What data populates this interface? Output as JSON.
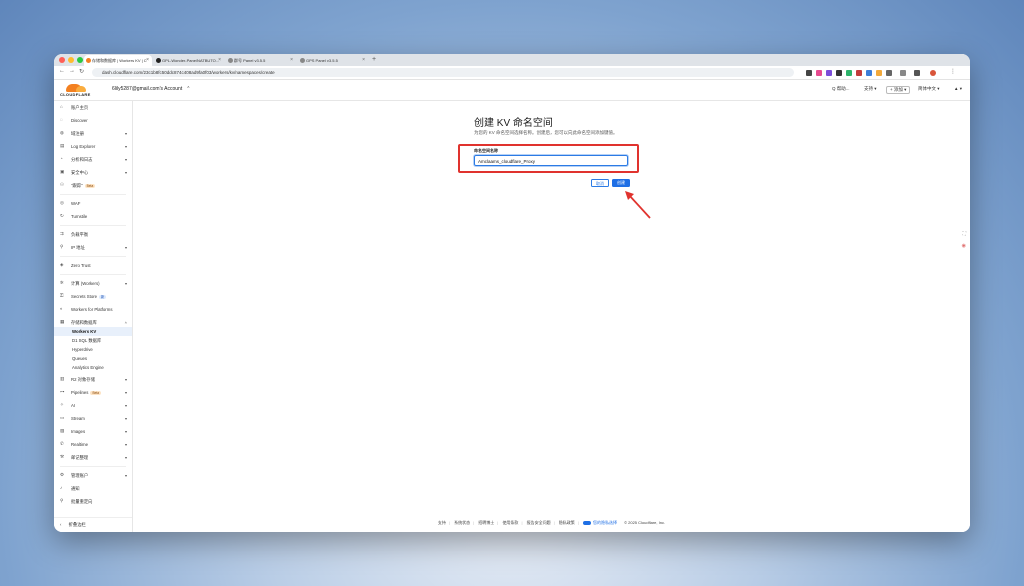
{
  "browser": {
    "tabs": [
      {
        "label": "存储和数据库 | Workers KV | C"
      },
      {
        "label": "GPL-Wonder-Pane/NATBUTO..."
      },
      {
        "label": "群号 Panel v3.5.5"
      },
      {
        "label": "GPS Panel v3.5.5"
      }
    ],
    "url": "dash.cloudflare.com/23c1b8fc50ddc874c408ad9fa0f03/workers/kv/namespaces/create"
  },
  "header": {
    "logo_text": "CLOUDFLARE",
    "account": "6lily5287@gmail.com's Account",
    "search": "Q 帮助...",
    "support": "支持 ▾",
    "add": "+ 添加 ▾",
    "language": "简体中文 ▾",
    "user": "▲ ▾"
  },
  "sidebar": {
    "items": [
      {
        "label": "账户主页",
        "icon": "home-icon"
      },
      {
        "label": "Discover",
        "icon": "bulb-icon"
      },
      {
        "label": "域注册",
        "icon": "globe-icon"
      },
      {
        "label": "Log Explorer",
        "icon": "log-icon"
      },
      {
        "label": "分析和日志",
        "icon": "chart-icon"
      },
      {
        "label": "安全中心",
        "icon": "shield-icon"
      },
      {
        "label": "\"跟踪\"",
        "icon": "users-icon",
        "badge": "Beta"
      },
      {
        "label": "WAF",
        "icon": "waf-icon"
      },
      {
        "label": "Turnstile",
        "icon": "turnstile-icon"
      },
      {
        "label": "负载平衡",
        "icon": "balance-icon"
      },
      {
        "label": "IP 地址",
        "icon": "ip-icon"
      },
      {
        "label": "Zero Trust",
        "icon": "zerotrust-icon"
      },
      {
        "label": "计算 (Workers)",
        "icon": "compute-icon"
      },
      {
        "label": "Secrets Store",
        "icon": "key-icon",
        "badge": "新"
      },
      {
        "label": "Workers for Platforms",
        "icon": "platform-icon"
      },
      {
        "label": "存储和数据库",
        "icon": "database-icon"
      },
      {
        "label": "Workers KV"
      },
      {
        "label": "D1 SQL 数据库"
      },
      {
        "label": "Hyperdrive"
      },
      {
        "label": "Queues"
      },
      {
        "label": "Analytics Engine"
      },
      {
        "label": "R2 对象存储",
        "icon": "bucket-icon"
      },
      {
        "label": "Pipelines",
        "icon": "pipeline-icon",
        "badge": "Beta"
      },
      {
        "label": "AI",
        "icon": "ai-icon"
      },
      {
        "label": "Stream",
        "icon": "stream-icon"
      },
      {
        "label": "Images",
        "icon": "image-icon"
      },
      {
        "label": "Realtime",
        "icon": "phone-icon"
      },
      {
        "label": " 邮记整理",
        "icon": "tool-icon"
      },
      {
        "label": "管理账户",
        "icon": "gear-icon"
      },
      {
        "label": "通知",
        "icon": "bell-icon"
      },
      {
        "label": "批量重定向",
        "icon": "redirect-icon"
      }
    ],
    "collapse_label": "折叠边栏"
  },
  "main": {
    "title": "创建 KV 命名空间",
    "description": "为您的 KV 命名空间选择名称。创建后，您可以向此命名空间添加键值。",
    "field_label": "命名空间名称",
    "field_value": "Amclaams_cloudflare_Proxy",
    "cancel_label": "取消",
    "create_label": "创建"
  },
  "footer": {
    "links": [
      "支持",
      "系统状态",
      "招聘博士",
      "使用条款",
      "报告安全问题",
      "隐私政策"
    ],
    "privacy_choice": "您的隐私选择",
    "copyright": "© 2025 Cloudflare, Inc."
  },
  "colors": {
    "accent": "#1f6fe5",
    "brand": "#f38020",
    "highlight": "#e0332e"
  }
}
